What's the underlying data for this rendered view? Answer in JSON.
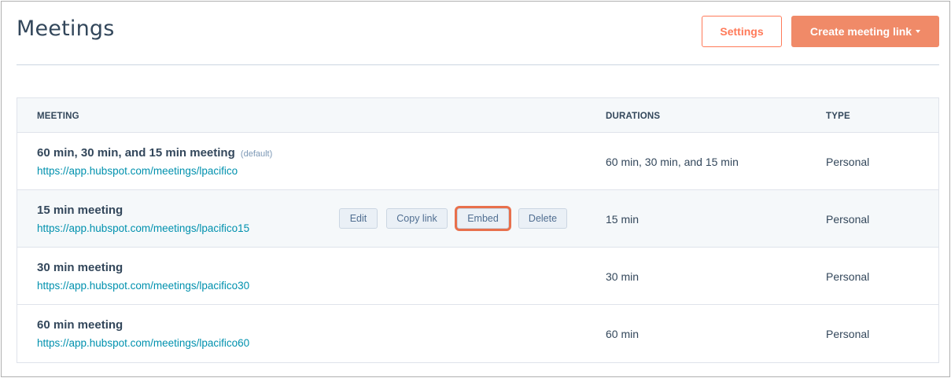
{
  "header": {
    "title": "Meetings",
    "settings_label": "Settings",
    "create_label": "Create meeting link"
  },
  "table": {
    "columns": [
      "MEETING",
      "DURATIONS",
      "TYPE"
    ],
    "rows": [
      {
        "name": "60 min, 30 min, and 15 min meeting",
        "badge": "(default)",
        "link": "https://app.hubspot.com/meetings/lpacifico",
        "duration": "60 min, 30 min, and 15 min",
        "type": "Personal"
      },
      {
        "name": "15 min meeting",
        "link": "https://app.hubspot.com/meetings/lpacifico15",
        "duration": "15 min",
        "type": "Personal",
        "actions": [
          "Edit",
          "Copy link",
          "Embed",
          "Delete"
        ]
      },
      {
        "name": "30 min meeting",
        "link": "https://app.hubspot.com/meetings/lpacifico30",
        "duration": "30 min",
        "type": "Personal"
      },
      {
        "name": "60 min meeting",
        "link": "https://app.hubspot.com/meetings/lpacifico60",
        "duration": "60 min",
        "type": "Personal"
      }
    ]
  },
  "colors": {
    "accent": "#ff7a59",
    "link": "#0091ae",
    "text": "#33475b",
    "highlight": "#e8704c"
  },
  "icons": {
    "create_dropdown": "caret-down-icon"
  }
}
